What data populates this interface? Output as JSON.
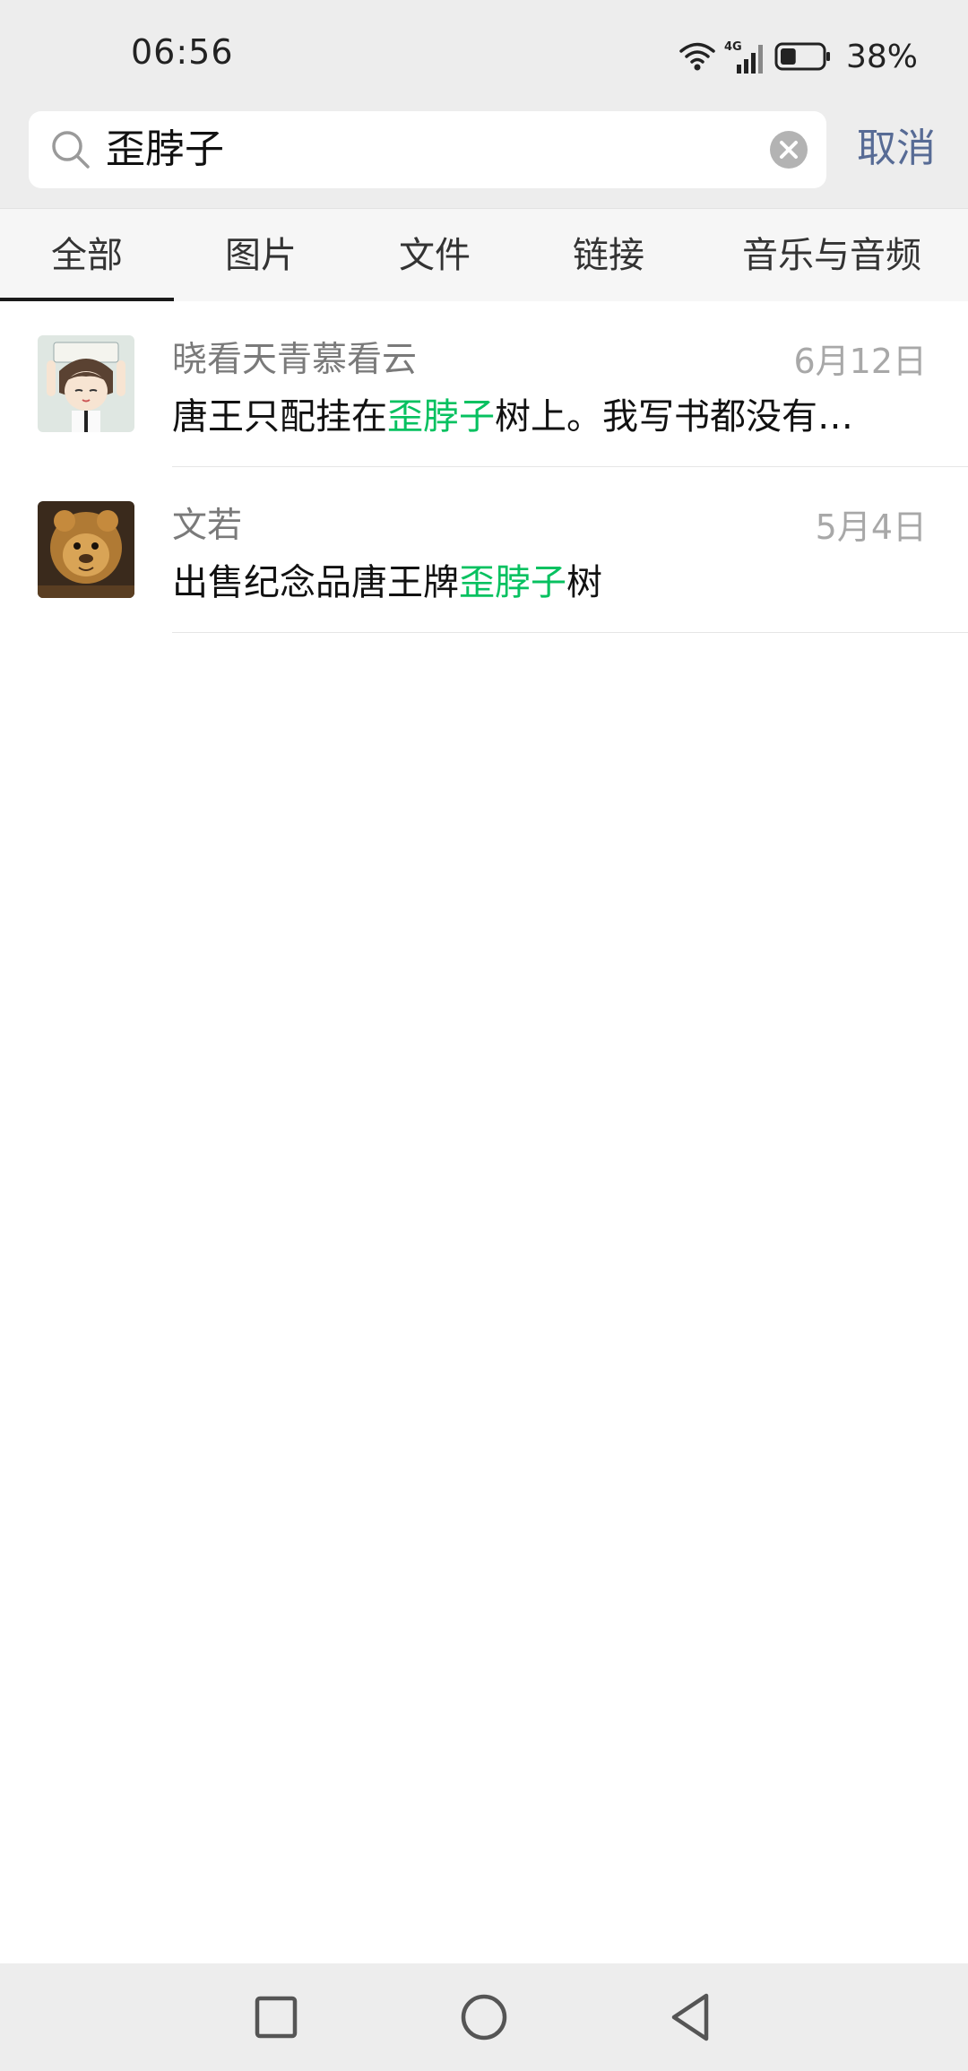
{
  "status_bar": {
    "time": "06:56",
    "network": "4G",
    "battery_percent": "38%",
    "battery_level": 0.38
  },
  "search": {
    "query": "歪脖子",
    "cancel_label": "取消"
  },
  "tabs": [
    {
      "label": "全部",
      "active": true
    },
    {
      "label": "图片",
      "active": false
    },
    {
      "label": "文件",
      "active": false
    },
    {
      "label": "链接",
      "active": false
    },
    {
      "label": "音乐与音频",
      "active": false
    }
  ],
  "results": [
    {
      "name": "晓看天青慕看云",
      "date": "6月12日",
      "snippet_before": "唐王只配挂在",
      "snippet_match": "歪脖子",
      "snippet_after": "树上。我写书都没有…"
    },
    {
      "name": "文若",
      "date": "5月4日",
      "snippet_before": "出售纪念品唐王牌",
      "snippet_match": "歪脖子",
      "snippet_after": "树"
    }
  ],
  "colors": {
    "highlight": "#07c160",
    "cancel": "#576b95",
    "background": "#ededed"
  },
  "icons": [
    "wifi-icon",
    "signal-icon",
    "battery-icon",
    "search-icon",
    "clear-icon",
    "recent-apps-icon",
    "home-icon",
    "back-icon"
  ]
}
